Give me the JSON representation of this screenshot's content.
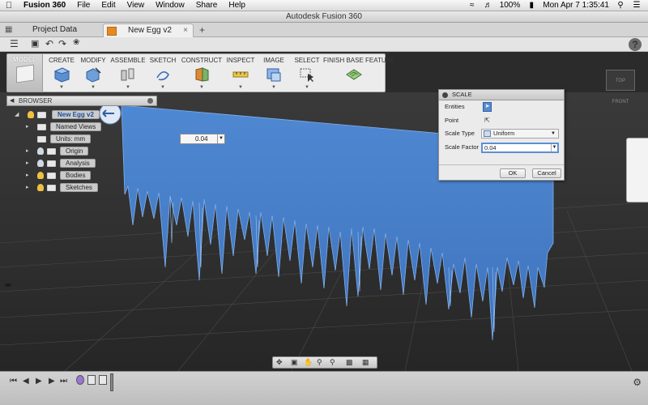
{
  "menubar": {
    "app_name": "Fusion 360",
    "items": [
      "File",
      "Edit",
      "View",
      "Window",
      "Share",
      "Help"
    ],
    "battery": "100%",
    "clock": "Mon Apr 7  1:35:41"
  },
  "window": {
    "title": "Autodesk Fusion 360"
  },
  "tabs": {
    "project_data": "Project Data",
    "document": "New Egg v2"
  },
  "ribbon": {
    "model_label": "MODEL",
    "groups": [
      "CREATE",
      "MODIFY",
      "ASSEMBLE",
      "SKETCH",
      "CONSTRUCT",
      "INSPECT",
      "IMAGE",
      "SELECT",
      "FINISH BASE FEATURE"
    ]
  },
  "browser": {
    "title": "BROWSER",
    "root": "New Egg v2",
    "items": [
      "Named Views",
      "Units: mm",
      "Origin",
      "Analysis",
      "Bodies",
      "Sketches"
    ]
  },
  "viewport": {
    "value_box": "0.04"
  },
  "scale_dialog": {
    "title": "SCALE",
    "entities_label": "Entities",
    "point_label": "Point",
    "scale_type_label": "Scale Type",
    "scale_type_value": "Uniform",
    "scale_factor_label": "Scale Factor",
    "scale_factor_value": "0.04",
    "ok": "OK",
    "cancel": "Cancel"
  },
  "colors": {
    "mesh_fill": "#4e86cf",
    "accent": "#5d8fd6",
    "viewport_bg": "#2e2e2e"
  }
}
